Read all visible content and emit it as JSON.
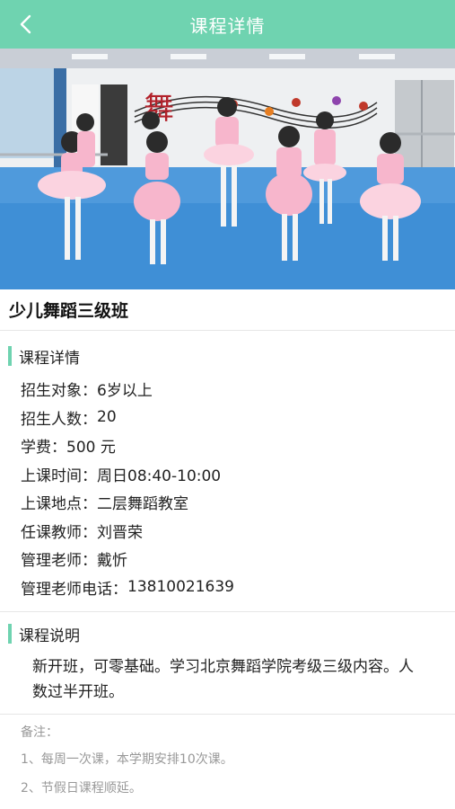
{
  "header": {
    "title": "课程详情",
    "back_icon": "chevron-left-icon",
    "background": "#6fd3b0"
  },
  "hero": {
    "description_icon": "dance-class-photo"
  },
  "course": {
    "name": "少儿舞蹈三级班"
  },
  "details_section": {
    "title": "课程详情",
    "rows": [
      {
        "key": "招生对象：",
        "value": "6岁以上"
      },
      {
        "key": "招生人数：",
        "value": "20"
      },
      {
        "key": "学费：",
        "value": "500 元"
      },
      {
        "key": "上课时间：",
        "value": "周日08:40-10:00"
      },
      {
        "key": "上课地点：",
        "value": "二层舞蹈教室"
      },
      {
        "key": "任课教师：",
        "value": "刘晋荣"
      },
      {
        "key": "管理老师：",
        "value": "戴忻"
      },
      {
        "key": "管理老师电话：",
        "value": "13810021639"
      }
    ]
  },
  "description_section": {
    "title": "课程说明",
    "text": "新开班，可零基础。学习北京舞蹈学院考级三级内容。人数过半开班。"
  },
  "notes": {
    "heading": "备注：",
    "items": [
      "1、每周一次课，本学期安排10次课。",
      "2、节假日课程顺延。"
    ]
  },
  "colors": {
    "accent": "#6fd3b0",
    "muted_text": "#999999"
  }
}
